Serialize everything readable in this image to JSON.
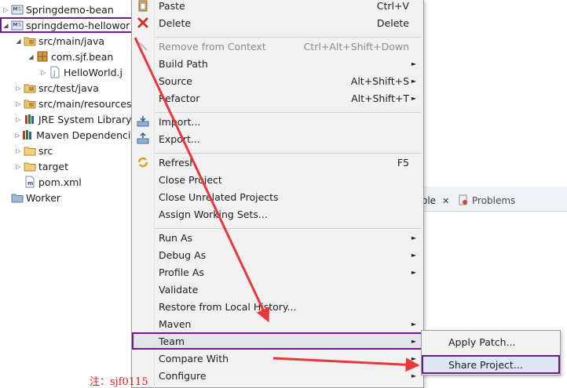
{
  "tree": {
    "items": [
      {
        "label": "Springdemo-bean",
        "depth": 0,
        "expander": "collapsed",
        "icon": "maven-project-icon",
        "selected": false
      },
      {
        "label": "springdemo-hellowor",
        "depth": 0,
        "expander": "expanded",
        "icon": "maven-project-icon",
        "selected": true
      },
      {
        "label": "src/main/java",
        "depth": 1,
        "expander": "expanded",
        "icon": "source-folder-icon",
        "selected": false
      },
      {
        "label": "com.sjf.bean",
        "depth": 2,
        "expander": "expanded",
        "icon": "package-icon",
        "selected": false
      },
      {
        "label": "HelloWorld.j",
        "depth": 3,
        "expander": "collapsed",
        "icon": "java-file-icon",
        "selected": false
      },
      {
        "label": "src/test/java",
        "depth": 1,
        "expander": "collapsed",
        "icon": "source-folder-icon",
        "selected": false
      },
      {
        "label": "src/main/resources",
        "depth": 1,
        "expander": "collapsed",
        "icon": "source-folder-icon",
        "selected": false
      },
      {
        "label": "JRE System Library",
        "depth": 1,
        "expander": "collapsed",
        "icon": "library-icon",
        "selected": false
      },
      {
        "label": "Maven Dependencie",
        "depth": 1,
        "expander": "collapsed",
        "icon": "library-icon",
        "selected": false
      },
      {
        "label": "src",
        "depth": 1,
        "expander": "collapsed",
        "icon": "folder-icon",
        "selected": false
      },
      {
        "label": "target",
        "depth": 1,
        "expander": "collapsed",
        "icon": "folder-icon",
        "selected": false
      },
      {
        "label": "pom.xml",
        "depth": 1,
        "expander": "none",
        "icon": "xml-file-icon",
        "selected": false
      },
      {
        "label": "Worker",
        "depth": 0,
        "expander": "none",
        "icon": "working-set-icon",
        "selected": false
      }
    ]
  },
  "editor": {
    "console_tab": "ole",
    "problems_tab": "Problems"
  },
  "menu": {
    "items": [
      {
        "label": "Paste",
        "shortcut": "Ctrl+V",
        "icon": "paste-icon"
      },
      {
        "label": "Delete",
        "shortcut": "Delete",
        "icon": "delete-icon"
      },
      {
        "sep": true
      },
      {
        "label": "Remove from Context",
        "shortcut": "Ctrl+Alt+Shift+Down",
        "icon": "remove-context-icon",
        "disabled": true
      },
      {
        "label": "Build Path",
        "submenu": true
      },
      {
        "label": "Source",
        "shortcut": "Alt+Shift+S",
        "submenu": true
      },
      {
        "label": "Refactor",
        "shortcut": "Alt+Shift+T",
        "submenu": true
      },
      {
        "sep": true
      },
      {
        "label": "Import...",
        "icon": "import-icon"
      },
      {
        "label": "Export...",
        "icon": "export-icon"
      },
      {
        "sep": true
      },
      {
        "label": "Refresh",
        "shortcut": "F5",
        "icon": "refresh-icon"
      },
      {
        "label": "Close Project"
      },
      {
        "label": "Close Unrelated Projects"
      },
      {
        "label": "Assign Working Sets..."
      },
      {
        "sep": true
      },
      {
        "label": "Run As",
        "submenu": true
      },
      {
        "label": "Debug As",
        "submenu": true
      },
      {
        "label": "Profile As",
        "submenu": true
      },
      {
        "label": "Validate"
      },
      {
        "label": "Restore from Local History..."
      },
      {
        "label": "Maven",
        "submenu": true
      },
      {
        "label": "Team",
        "submenu": true,
        "highlighted": true
      },
      {
        "label": "Compare With",
        "submenu": true
      },
      {
        "label": "Configure",
        "submenu": true
      }
    ],
    "submenu_arrow": "►"
  },
  "team_submenu": {
    "items": [
      {
        "label": "Apply Patch..."
      },
      {
        "label": "Share Project...",
        "highlighted": true
      }
    ]
  },
  "annotation": {
    "note": "注：sjf0115"
  },
  "colors": {
    "highlight_border": "#6e1b8a",
    "arrow": "#e8383b"
  }
}
